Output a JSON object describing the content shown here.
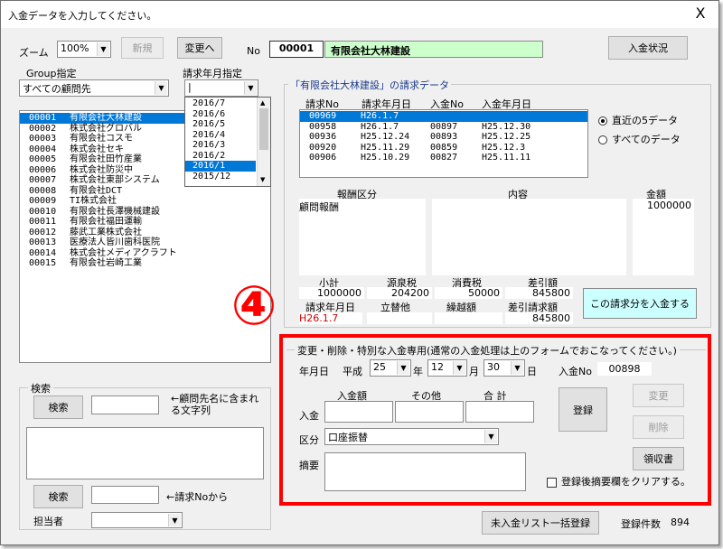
{
  "window": {
    "title": "入金データを入力してください。",
    "close_glyph": "X"
  },
  "toolbar": {
    "zoom_label": "ズーム",
    "zoom_value": "100%",
    "new_button": "新規",
    "change_button": "変更へ",
    "no_label": "No",
    "record_no": "00001",
    "company_name": "有限会社大林建設",
    "status_button": "入金状況"
  },
  "group": {
    "label": "Group指定",
    "value": "すべての顧問先"
  },
  "billing_month": {
    "label": "請求年月指定",
    "value": "|",
    "options": [
      "2016/7",
      "2016/6",
      "2016/5",
      "2016/4",
      "2016/3",
      "2016/2",
      "2016/1",
      "2015/12"
    ],
    "selected": "2016/1"
  },
  "clients": [
    {
      "code": "00001",
      "name": "有限会社大林建設",
      "selected": true
    },
    {
      "code": "00002",
      "name": "株式会社グロバル"
    },
    {
      "code": "00003",
      "name": "有限会社コスモ"
    },
    {
      "code": "00004",
      "name": "株式会社セキ"
    },
    {
      "code": "00005",
      "name": "有限会社田竹産業"
    },
    {
      "code": "00006",
      "name": "株式会社防災中"
    },
    {
      "code": "00007",
      "name": "株式会社東部システム"
    },
    {
      "code": "00008",
      "name": "有限会社DCT"
    },
    {
      "code": "00009",
      "name": "TI株式会社"
    },
    {
      "code": "00010",
      "name": "有限会社長澤機械建設"
    },
    {
      "code": "00011",
      "name": "有限会社福田運輸"
    },
    {
      "code": "00012",
      "name": "藤武工業株式会社"
    },
    {
      "code": "00013",
      "name": "医療法人皆川歯科医院"
    },
    {
      "code": "00014",
      "name": "株式会社メディアクラフト"
    },
    {
      "code": "00015",
      "name": "有限会社岩崎工業"
    }
  ],
  "search": {
    "title": "検索",
    "button1": "検索",
    "hint1": "←顧問先名に含まれる文字列",
    "button2": "検索",
    "hint2": "←請求Noから",
    "person_label": "担当者"
  },
  "invoice": {
    "group_title": "「有限会社大林建設」の請求データ",
    "headers": [
      "請求No",
      "請求年月日",
      "入金No",
      "入金年月日"
    ],
    "rows": [
      {
        "no": "00969",
        "date": "H26.1.7",
        "pay_no": "",
        "pay_date": "",
        "selected": true
      },
      {
        "no": "00958",
        "date": "H26.1.7",
        "pay_no": "00897",
        "pay_date": "H25.12.30"
      },
      {
        "no": "00936",
        "date": "H25.12.24",
        "pay_no": "00893",
        "pay_date": "H25.12.25"
      },
      {
        "no": "00920",
        "date": "H25.11.29",
        "pay_no": "00859",
        "pay_date": "H25.12.3"
      },
      {
        "no": "00906",
        "date": "H25.10.29",
        "pay_no": "00827",
        "pay_date": "H25.11.11"
      }
    ],
    "radio_recent": "直近の5データ",
    "radio_all": "すべてのデータ",
    "fee_label": "報酬区分",
    "content_label": "内容",
    "amount_label": "金額",
    "fee_value": "顧問報酬",
    "amount_value": "1000000",
    "subtotal_label": "小計",
    "source_tax_label": "源泉税",
    "consumption_tax_label": "消費税",
    "billed_label": "差引額",
    "subtotal": "1000000",
    "source_tax": "204200",
    "consumption_tax": "50000",
    "billed": "845800",
    "bill_date_label": "請求年月日",
    "advance_label": "立替他",
    "carryover_label": "繰越額",
    "billed_total_label": "差引請求額",
    "bill_date": "H26.1.7",
    "billed_total": "845800",
    "pay_button": "この請求分を入金する",
    "marker": "④"
  },
  "special": {
    "title": "変更・削除・特別な入金専用(通常の入金処理は上のフォームでおこなってください。)",
    "date_label": "年月日",
    "era": "平成",
    "year": "25",
    "year_unit": "年",
    "month": "12",
    "month_unit": "月",
    "day": "30",
    "day_unit": "日",
    "pay_no_label": "入金No",
    "pay_no": "00898",
    "deposit_label": "入金",
    "amount_header": "入金額",
    "other_header": "その他",
    "total_header": "合 計",
    "type_label": "区分",
    "type_value": "口座振替",
    "memo_label": "摘要",
    "register_button": "登録",
    "change_button": "変更",
    "delete_button": "削除",
    "receipt_button": "領収書",
    "clear_memo_label": "登録後摘要欄をクリアする。"
  },
  "footer": {
    "bulk_button": "未入金リスト一括登録",
    "count_label": "登録件数",
    "count": "894"
  }
}
